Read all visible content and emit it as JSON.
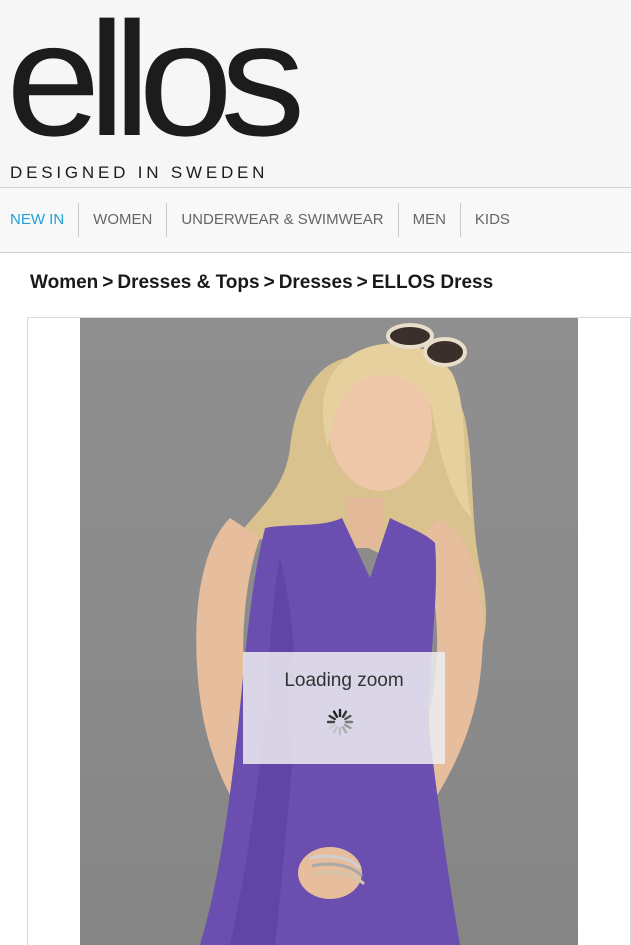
{
  "header": {
    "logo_text": "ellos",
    "tagline": "DESIGNED IN SWEDEN"
  },
  "nav": {
    "items": [
      {
        "label": "NEW IN",
        "active": true
      },
      {
        "label": "WOMEN"
      },
      {
        "label": "UNDERWEAR & SWIMWEAR"
      },
      {
        "label": "MEN"
      },
      {
        "label": "KIDS"
      }
    ]
  },
  "breadcrumb": {
    "items": [
      "Women",
      "Dresses & Tops",
      "Dresses",
      "ELLOS Dress"
    ],
    "separator": ">"
  },
  "product": {
    "loading_text": "Loading zoom",
    "dress_color": "#6a4fb0"
  },
  "colors": {
    "nav_active": "#1fa2d6",
    "nav_text": "#666666",
    "logo": "#1c1c1c"
  },
  "icons": {
    "spinner": "loading-spinner-icon"
  }
}
